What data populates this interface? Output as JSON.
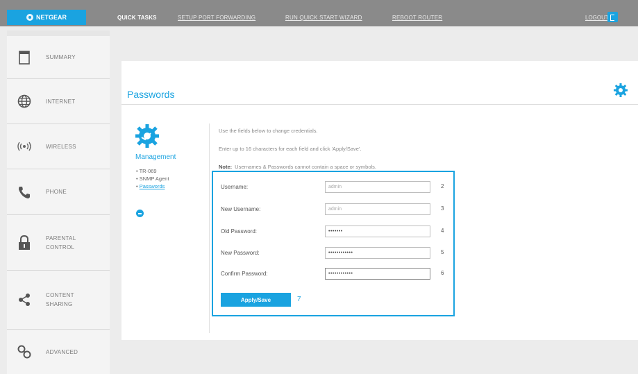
{
  "header": {
    "logo_text": "NETGEAR",
    "quick_tasks_label": "QUICK TASKS",
    "links": [
      "SETUP PORT FORWARDING",
      "RUN QUICK START WIZARD",
      "REBOOT ROUTER"
    ],
    "logout_label": "LOGOUT"
  },
  "sidebar": {
    "items": [
      {
        "label": "SUMMARY",
        "icon": "document-icon"
      },
      {
        "label": "INTERNET",
        "icon": "globe-icon"
      },
      {
        "label": "WIRELESS",
        "icon": "wireless-icon"
      },
      {
        "label": "PHONE",
        "icon": "phone-icon"
      },
      {
        "label": "PARENTAL\nCONTROL",
        "icon": "lock-icon"
      },
      {
        "label": "CONTENT\nSHARING",
        "icon": "share-icon"
      },
      {
        "label": "ADVANCED",
        "icon": "settings-icon"
      }
    ]
  },
  "main": {
    "title": "Passwords",
    "management": {
      "label": "Management",
      "items": [
        "TR-069",
        "SNMP Agent",
        "Passwords"
      ]
    },
    "instructions": [
      "Use the fields below to change credentials.",
      "Enter up to 16 characters for each field and click 'Apply/Save'."
    ],
    "note_label": "Note:",
    "note_text": "Usernames & Passwords cannot contain a space or symbols.",
    "form": {
      "fields": [
        {
          "label": "Username:",
          "value": "admin",
          "number": "2"
        },
        {
          "label": "New Username:",
          "value": "admin",
          "number": "3"
        },
        {
          "label": "Old Password:",
          "value": "•••••••",
          "number": "4"
        },
        {
          "label": "New Password:",
          "value": "••••••••••••",
          "number": "5"
        },
        {
          "label": "Confirm Password:",
          "value": "••••••••••••",
          "number": "6"
        }
      ],
      "apply_label": "Apply/Save",
      "apply_number": "7"
    }
  },
  "colors": {
    "accent": "#1aa3e0",
    "topbar": "#8a8a8a",
    "background": "#ececec"
  }
}
